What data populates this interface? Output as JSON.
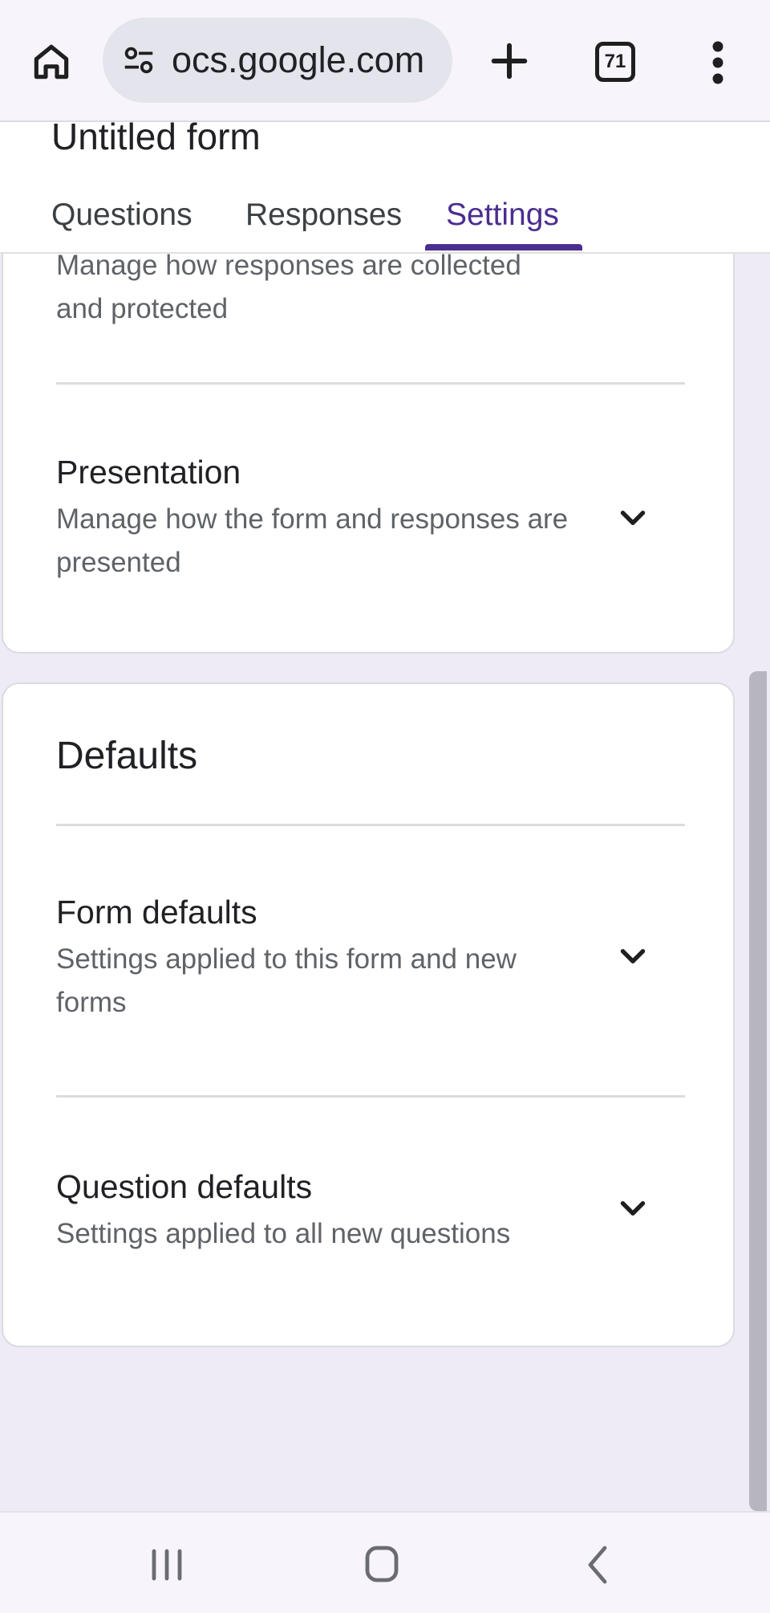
{
  "browser": {
    "url": "ocs.google.com",
    "tab_count": "71",
    "icons": [
      "home-icon",
      "site-settings-icon",
      "plus-icon",
      "tab-switcher-icon",
      "more-vert-icon"
    ]
  },
  "form": {
    "title": "Untitled form",
    "tabs": [
      {
        "label": "Questions"
      },
      {
        "label": "Responses"
      },
      {
        "label": "Settings",
        "active": true
      }
    ]
  },
  "settings": {
    "responses_partial": {
      "subtitle_line1": "Manage how responses are collected",
      "subtitle_line2": "and protected"
    },
    "presentation": {
      "title": "Presentation",
      "subtitle": "Manage how the form and responses are presented"
    },
    "defaults": {
      "title": "Defaults",
      "form_defaults": {
        "title": "Form defaults",
        "subtitle": "Settings applied to this form and new forms"
      },
      "question_defaults": {
        "title": "Question defaults",
        "subtitle": "Settings applied to all new questions"
      }
    }
  },
  "navbar": {
    "icons": [
      "recent-apps-icon",
      "home-button-icon",
      "back-icon"
    ]
  },
  "colors": {
    "accent": "#4b2e8f",
    "page_background": "#eeeaf6",
    "card_background": "#ffffff",
    "secondary_text": "#5f6368"
  }
}
